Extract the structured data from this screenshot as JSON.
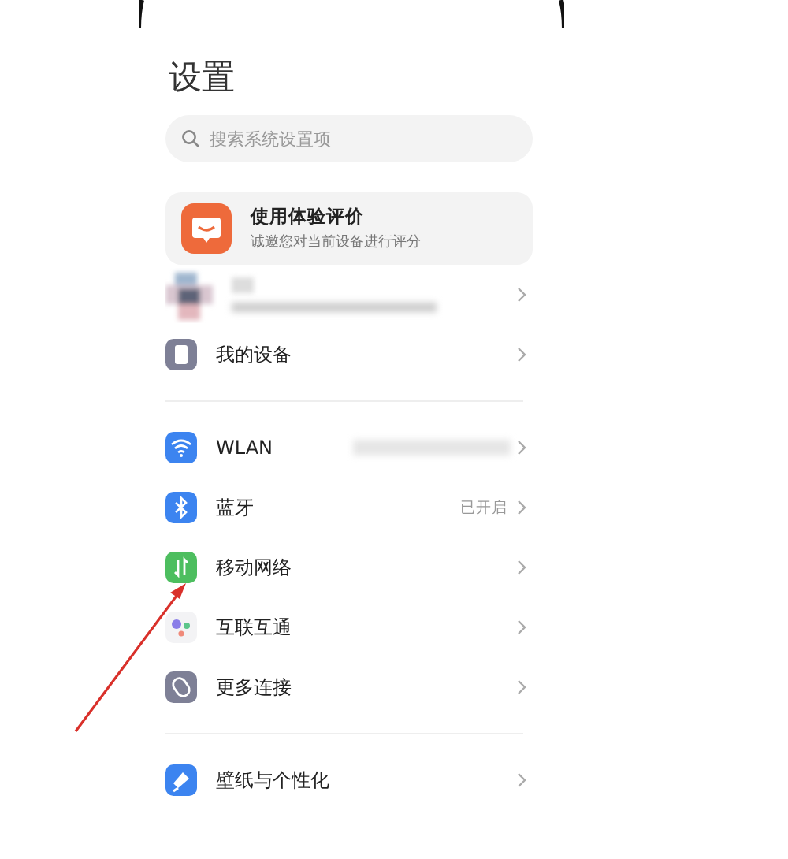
{
  "title": "设置",
  "search": {
    "placeholder": "搜索系统设置项"
  },
  "feedback_card": {
    "title": "使用体验评价",
    "subtitle": "诚邀您对当前设备进行评分"
  },
  "groups": [
    {
      "rows": [
        {
          "kind": "blurred",
          "value_blurred": false
        },
        {
          "kind": "device",
          "label": "我的设备",
          "value_blurred": false
        }
      ]
    },
    {
      "rows": [
        {
          "kind": "wifi",
          "label": "WLAN",
          "value_blurred": true
        },
        {
          "kind": "bluetooth",
          "label": "蓝牙",
          "value": "已开启",
          "value_blurred": false
        },
        {
          "kind": "mobile",
          "label": "移动网络",
          "value_blurred": false
        },
        {
          "kind": "connect",
          "label": "互联互通",
          "value_blurred": false
        },
        {
          "kind": "link",
          "label": "更多连接",
          "value_blurred": false
        }
      ]
    },
    {
      "rows": [
        {
          "kind": "wallpaper",
          "label": "壁纸与个性化",
          "value_blurred": false
        }
      ]
    }
  ],
  "annotation": {
    "kind": "arrow"
  }
}
